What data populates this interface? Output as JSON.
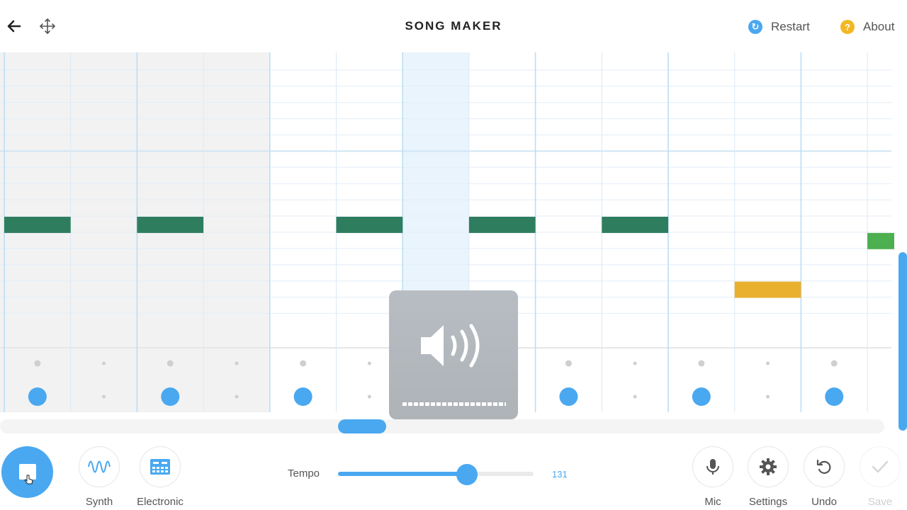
{
  "header": {
    "title": "SONG MAKER",
    "back_icon": "arrow-left-icon",
    "move_icon": "move-arrows-icon",
    "restart_label": "Restart",
    "restart_color": "#4aa8f0",
    "about_label": "About",
    "about_color": "#f2b824"
  },
  "grid": {
    "columns": 16,
    "melody_rows": 17,
    "highlighted_column": 6,
    "shaded_columns": [
      0,
      1,
      2,
      3
    ],
    "melody_notes": [
      {
        "col": 0,
        "row": 10,
        "color": "#2f7d5f"
      },
      {
        "col": 2,
        "row": 10,
        "color": "#2f7d5f"
      },
      {
        "col": 5,
        "row": 10,
        "color": "#2f7d5f"
      },
      {
        "col": 7,
        "row": 10,
        "color": "#2f7d5f"
      },
      {
        "col": 9,
        "row": 10,
        "color": "#2f7d5f"
      },
      {
        "col": 11,
        "row": 14,
        "color": "#e9b030"
      },
      {
        "col": 13,
        "row": 11,
        "color": "#4caf50"
      }
    ],
    "percussion_dots_top": [
      0,
      2,
      4,
      6,
      8,
      10,
      12
    ],
    "percussion_notes_bottom": [
      0,
      2,
      4,
      8,
      10,
      12
    ]
  },
  "overlay": {
    "icon": "speaker-volume-icon"
  },
  "footer": {
    "play_icon": "stop-square-icon",
    "synth_label": "Synth",
    "synth_icon": "waveform-icon",
    "electronic_label": "Electronic",
    "electronic_icon": "drum-machine-icon",
    "tempo_label": "Tempo",
    "tempo_value": "131",
    "tempo_fraction": 0.66,
    "mic_label": "Mic",
    "mic_icon": "microphone-icon",
    "settings_label": "Settings",
    "settings_icon": "gear-icon",
    "undo_label": "Undo",
    "undo_icon": "undo-icon",
    "save_label": "Save",
    "save_icon": "checkmark-icon"
  }
}
